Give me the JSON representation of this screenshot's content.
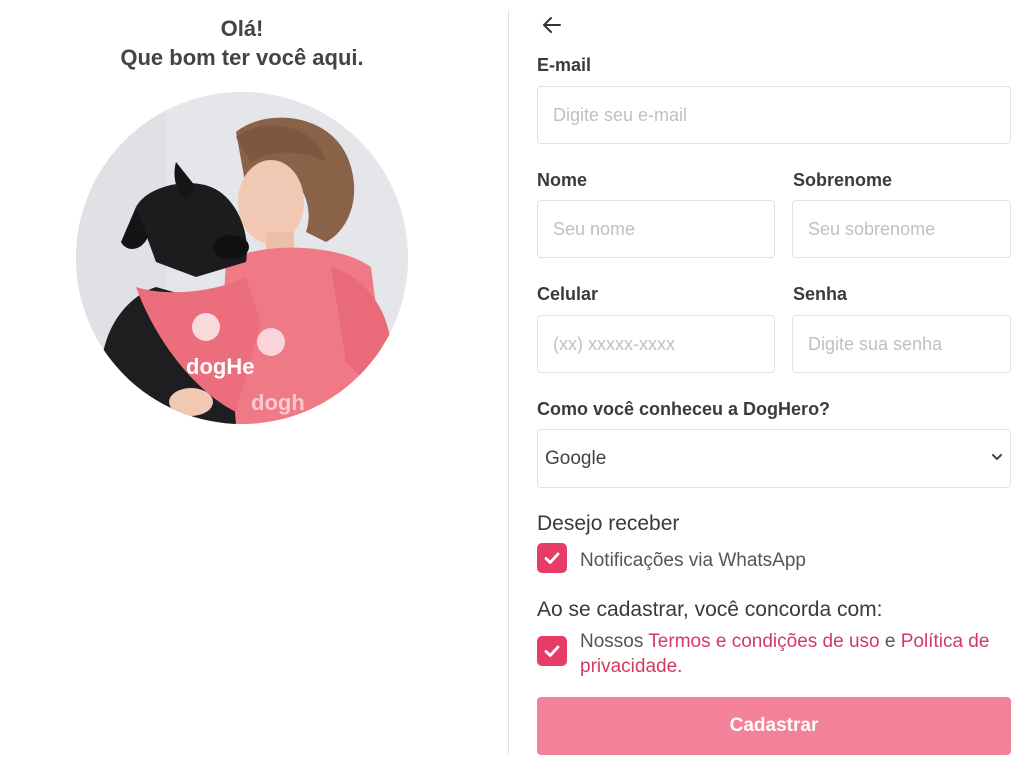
{
  "greeting": {
    "line1": "Olá!",
    "line2": "Que bom ter você aqui."
  },
  "form": {
    "email_label": "E-mail",
    "email_placeholder": "Digite seu e-mail",
    "first_name_label": "Nome",
    "first_name_placeholder": "Seu nome",
    "last_name_label": "Sobrenome",
    "last_name_placeholder": "Seu sobrenome",
    "phone_label": "Celular",
    "phone_placeholder": "(xx) xxxxx-xxxx",
    "password_label": "Senha",
    "password_placeholder": "Digite sua senha",
    "source_label": "Como você conheceu a DogHero?",
    "source_value": "Google",
    "receive_title": "Desejo receber",
    "whatsapp_label": "Notificações via WhatsApp",
    "whatsapp_checked": true,
    "terms_title": "Ao se cadastrar, você concorda com:",
    "terms_prefix": "Nossos ",
    "terms_link": "Termos e condições de uso",
    "terms_and": " e ",
    "privacy_link": "Política de privacidade",
    "terms_suffix": ".",
    "terms_checked": true,
    "submit_label": "Cadastrar"
  },
  "photo": {
    "shirt_text": "dogh",
    "bandana_text": "dogHe"
  },
  "colors": {
    "accent": "#e63c66",
    "button": "#f38199",
    "link": "#d33a63"
  },
  "icons": {
    "back": "arrow-left-icon",
    "select": "chevron-down-icon",
    "check": "checkmark-icon"
  }
}
